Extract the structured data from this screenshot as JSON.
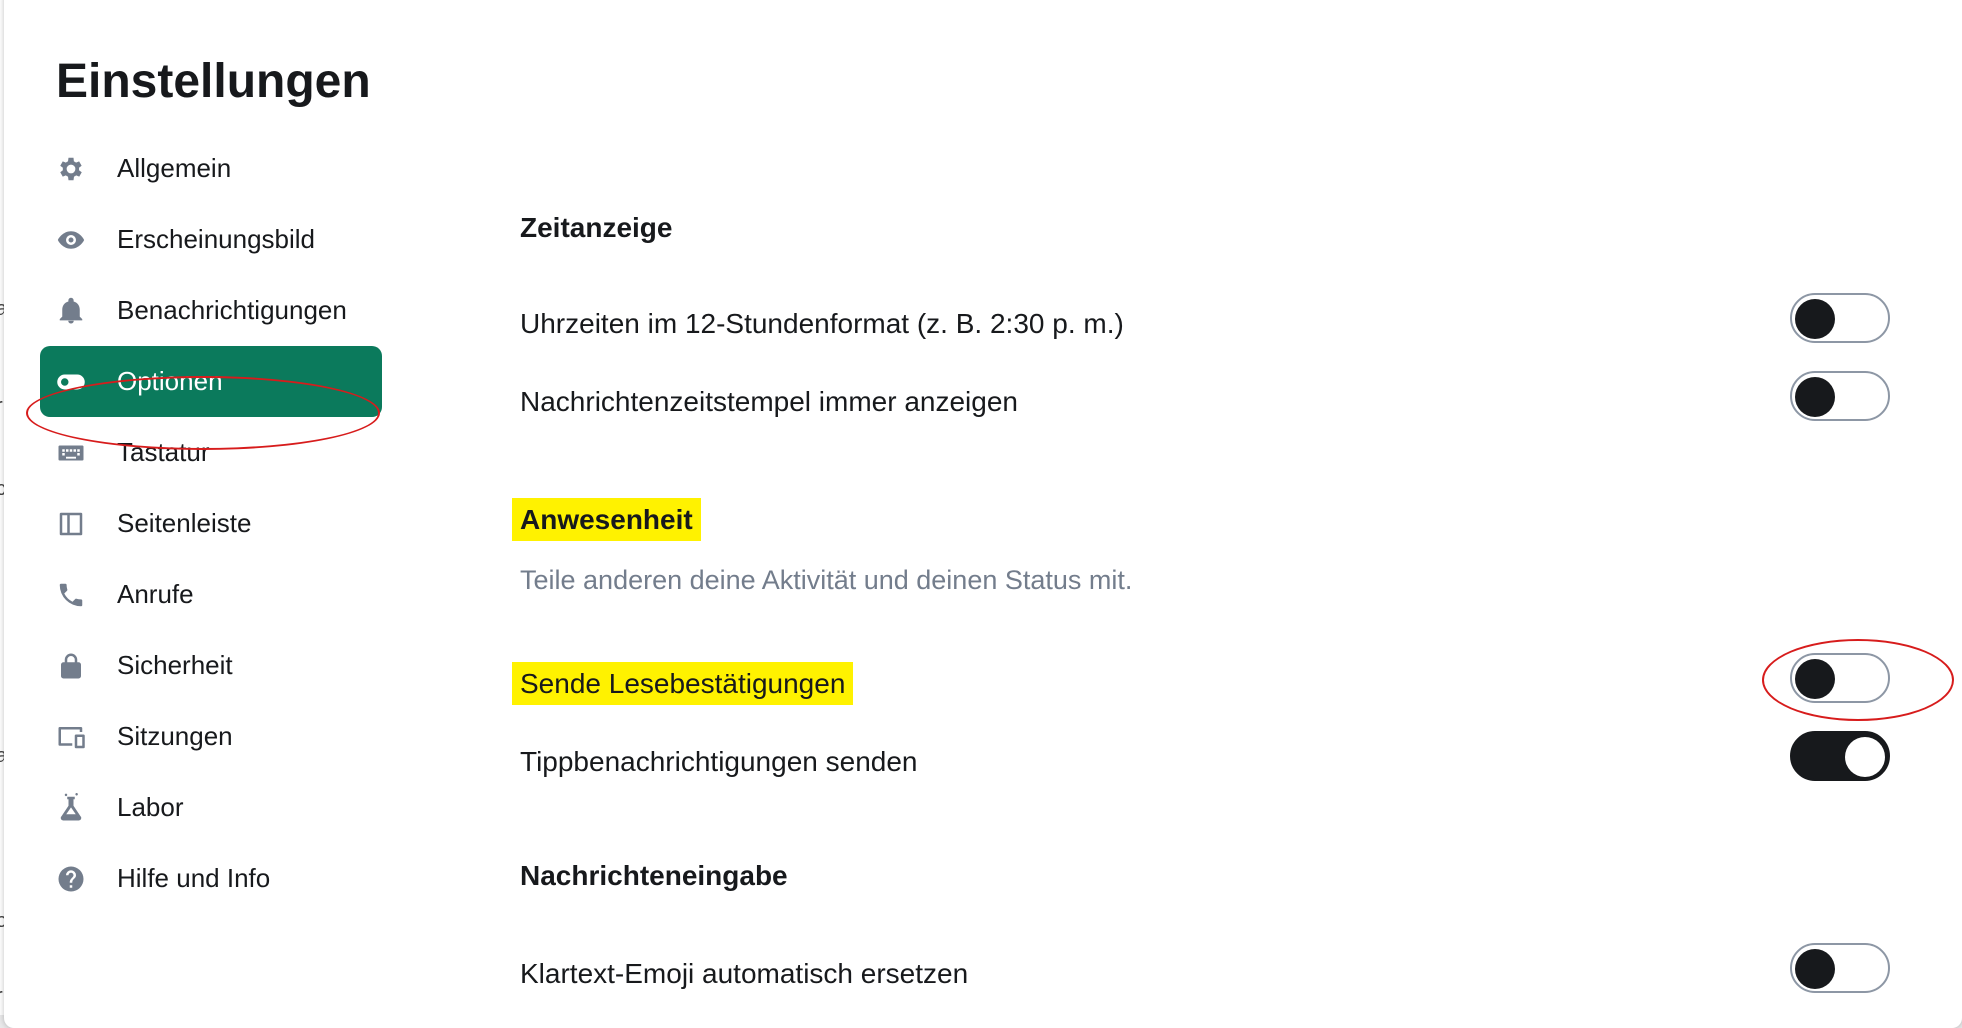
{
  "dialog": {
    "title": "Einstellungen"
  },
  "sidebar": {
    "items": [
      {
        "label": "Allgemein",
        "icon": "gear-icon"
      },
      {
        "label": "Erscheinungsbild",
        "icon": "eye-icon"
      },
      {
        "label": "Benachrichtigungen",
        "icon": "bell-icon"
      },
      {
        "label": "Optionen",
        "icon": "toggle-icon",
        "active": true
      },
      {
        "label": "Tastatur",
        "icon": "keyboard-icon"
      },
      {
        "label": "Seitenleiste",
        "icon": "sidebar-icon"
      },
      {
        "label": "Anrufe",
        "icon": "phone-icon"
      },
      {
        "label": "Sicherheit",
        "icon": "lock-icon"
      },
      {
        "label": "Sitzungen",
        "icon": "devices-icon"
      },
      {
        "label": "Labor",
        "icon": "flask-icon"
      },
      {
        "label": "Hilfe und Info",
        "icon": "help-icon"
      }
    ]
  },
  "sections": {
    "time": {
      "heading": "Zeitanzeige",
      "twelve_hour": {
        "label": "Uhrzeiten im 12-Stundenformat (z. B. 2:30 p. m.)",
        "on": false
      },
      "always_timestamps": {
        "label": "Nachrichtenzeitstempel immer anzeigen",
        "on": false
      }
    },
    "presence": {
      "heading": "Anwesenheit",
      "description": "Teile anderen deine Aktivität und deinen Status mit.",
      "read_receipts": {
        "label": "Sende Lesebestätigungen",
        "on": false
      },
      "typing_notifications": {
        "label": "Tippbenachrichtigungen senden",
        "on": true
      }
    },
    "composer": {
      "heading": "Nachrichteneingabe",
      "emoji_replace": {
        "label": "Klartext-Emoji automatisch ersetzen",
        "on": false
      }
    }
  },
  "colors": {
    "accent": "#0b7a5c",
    "highlight": "#fff200",
    "annotation": "#d71c1c",
    "toggle_dark": "#17191c"
  }
}
